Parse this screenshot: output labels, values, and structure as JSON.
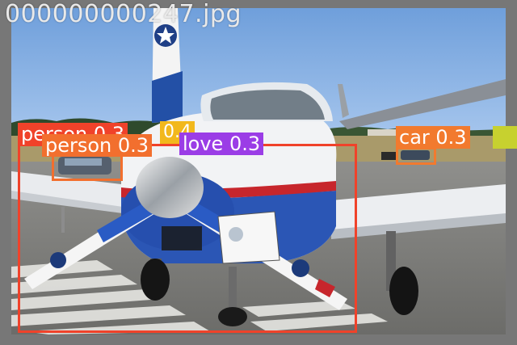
{
  "file_name": "000000000247.jpg",
  "colors": {
    "person": "#f0422a",
    "person_small": "#f26f2e",
    "glove": "#9b3de6",
    "car": "#f27a2e",
    "unknown_yellow": "#f2b81c",
    "unknown_lime": "#c7d12f"
  },
  "detections": [
    {
      "label": "person",
      "score": "0.3",
      "color": "#f26f2e"
    },
    {
      "label": "person",
      "score": "0.3",
      "color": "#f0422a"
    },
    {
      "label": "glove",
      "score": "0.3",
      "color": "#9b3de6"
    },
    {
      "label": "car",
      "score": "0.3",
      "color": "#f27a2e"
    }
  ],
  "overlay_labels": {
    "big_person": "person 0.3",
    "small_person": "person 0.3",
    "glove": "love 0.3",
    "car": "car 0.3",
    "yellow": "0.4"
  }
}
